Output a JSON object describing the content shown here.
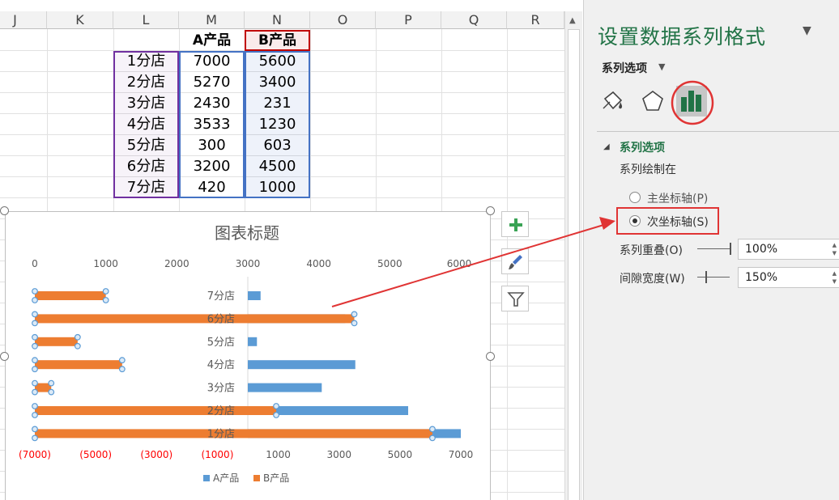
{
  "sheet": {
    "columns": [
      "J",
      "K",
      "L",
      "M",
      "N",
      "O",
      "P",
      "Q",
      "R"
    ],
    "table": {
      "headers": [
        "",
        "A产品",
        "B产品"
      ],
      "rows": [
        [
          "1分店",
          "7000",
          "5600"
        ],
        [
          "2分店",
          "5270",
          "3400"
        ],
        [
          "3分店",
          "2430",
          "231"
        ],
        [
          "4分店",
          "3533",
          "1230"
        ],
        [
          "5分店",
          "300",
          "603"
        ],
        [
          "6分店",
          "3200",
          "4500"
        ],
        [
          "7分店",
          "420",
          "1000"
        ]
      ]
    }
  },
  "chart_data": {
    "type": "bar",
    "title": "图表标题",
    "categories": [
      "1分店",
      "2分店",
      "3分店",
      "4分店",
      "5分店",
      "6分店",
      "7分店"
    ],
    "series": [
      {
        "name": "A产品",
        "values": [
          7000,
          5270,
          2430,
          3533,
          300,
          3200,
          420
        ],
        "color": "#5b9bd5",
        "axis": "primary"
      },
      {
        "name": "B产品",
        "values": [
          5600,
          3400,
          231,
          1230,
          603,
          4500,
          1000
        ],
        "color": "#ed7d31",
        "axis": "secondary"
      }
    ],
    "top_axis_ticks": [
      "0",
      "1000",
      "2000",
      "3000",
      "4000",
      "5000",
      "6000"
    ],
    "bottom_axis_ticks": [
      "(7000)",
      "(5000)",
      "(3000)",
      "(1000)",
      "1000",
      "3000",
      "5000",
      "7000"
    ],
    "bottom_axis_negative_color": "#ff0000",
    "primary_xlim": [
      -7000,
      7000
    ],
    "secondary_xlim": [
      0,
      6000
    ],
    "legend_position": "bottom",
    "selected_series": "B产品"
  },
  "chart_buttons": {
    "add": "plus-icon",
    "style": "brush-icon",
    "filter": "filter-icon"
  },
  "pane": {
    "title": "设置数据系列格式",
    "subtitle": "系列选项",
    "section_title": "系列选项",
    "plot_on_label": "系列绘制在",
    "primary_axis_label": "主坐标轴(P)",
    "secondary_axis_label": "次坐标轴(S)",
    "selected_axis": "secondary",
    "overlap_label": "系列重叠(O)",
    "overlap_value": "100%",
    "overlap_level": 100,
    "gap_label": "间隙宽度(W)",
    "gap_value": "150%",
    "gap_level": 150,
    "accent_color": "#217346",
    "annotation_color": "#e03434"
  }
}
